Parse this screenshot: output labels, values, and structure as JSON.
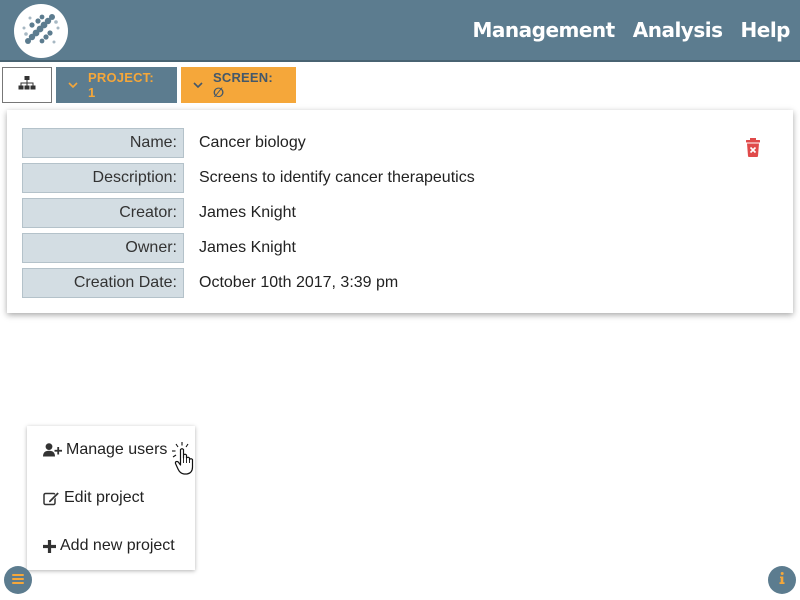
{
  "navbar": {
    "logo": "app-logo",
    "links": [
      "Management",
      "Analysis",
      "Help"
    ]
  },
  "toolbar": {
    "tree_icon": "sitemap-icon",
    "project_label": "PROJECT: 1",
    "screen_label": "SCREEN: ∅"
  },
  "details": {
    "rows": [
      {
        "label": "Name:",
        "value": "Cancer biology"
      },
      {
        "label": "Description:",
        "value": "Screens to identify cancer therapeutics"
      },
      {
        "label": "Creator:",
        "value": "James Knight"
      },
      {
        "label": "Owner:",
        "value": "James Knight"
      },
      {
        "label": "Creation Date:",
        "value": "October 10th 2017, 3:39 pm"
      }
    ],
    "delete_icon": "trash-icon"
  },
  "menu": {
    "items": [
      {
        "label": "Manage users",
        "icon": "user-plus-icon"
      },
      {
        "label": "Edit project",
        "icon": "edit-icon"
      },
      {
        "label": "Add new project",
        "icon": "plus-icon"
      }
    ]
  },
  "colors": {
    "navbar": "#5c7c8f",
    "accent": "#f5a73a",
    "label_bg": "#d3dde3",
    "danger": "#e04a4a"
  }
}
